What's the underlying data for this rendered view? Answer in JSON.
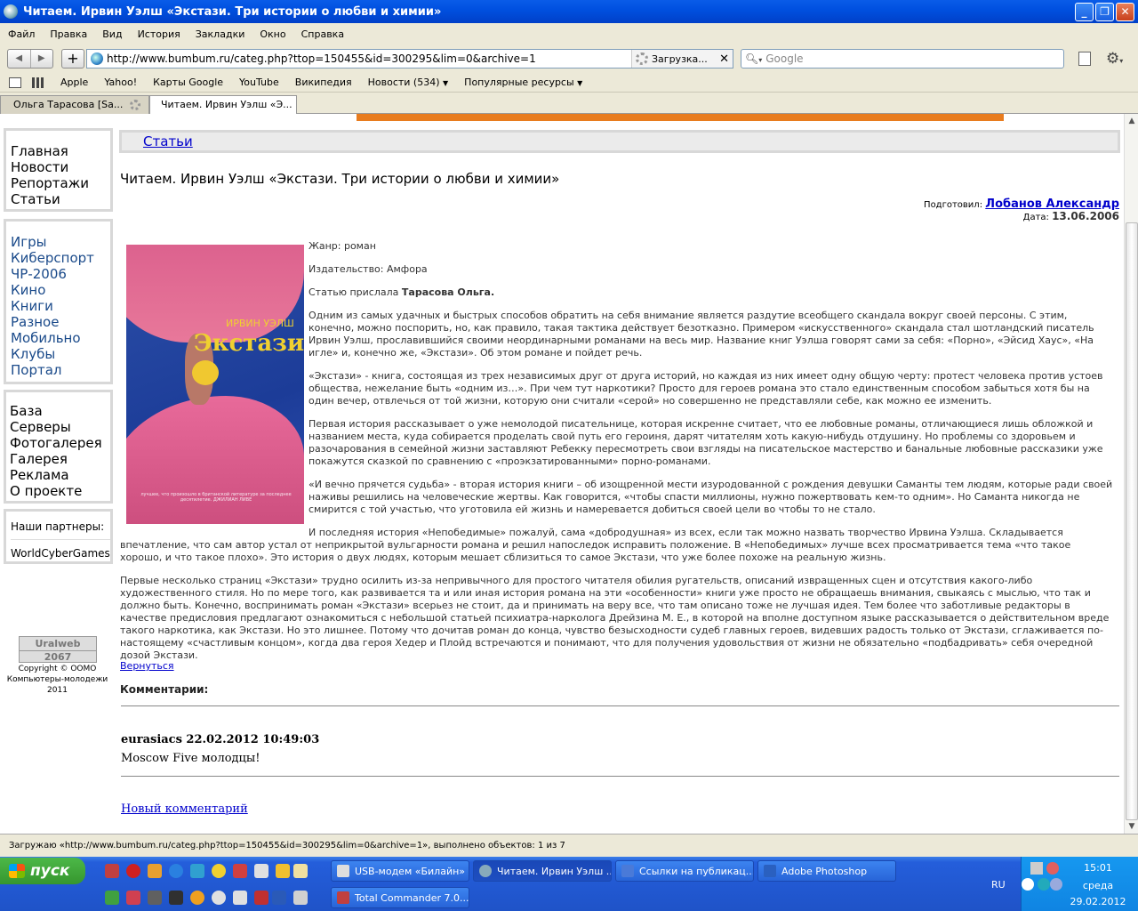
{
  "window": {
    "title": "Читаем. Ирвин Уэлш «Экстази. Три истории о любви и химии»"
  },
  "menu": [
    "Файл",
    "Правка",
    "Вид",
    "История",
    "Закладки",
    "Окно",
    "Справка"
  ],
  "nav": {
    "url": "http://www.bumbum.ru/categ.php?ttop=150455&id=300295&lim=0&archive=1",
    "loading_label": "Загрузка...",
    "search_placeholder": "Google"
  },
  "bookmarks": [
    "Apple",
    "Yahoo!",
    "Карты Google",
    "YouTube",
    "Википедия",
    "Новости (534)",
    "Популярные ресурсы"
  ],
  "tabs": [
    "Ольга Тарасова [Sa...",
    "Читаем. Ирвин Уэлш «Э..."
  ],
  "sidebar": {
    "main_links": [
      "Главная",
      "Новости",
      "Репортажи",
      "Статьи"
    ],
    "category_links": [
      "Игры",
      "Киберспорт",
      "ЧР-2006",
      "Кино",
      "Книги",
      "Разное",
      "Мобильно",
      "Клубы",
      "Портал"
    ],
    "other_links": [
      "База",
      "Серверы",
      "Фотогалерея",
      "Галерея",
      "Реклама",
      "О проекте"
    ],
    "partners_title": "Наши партнеры:",
    "partners": [
      "WorldCyberGames"
    ],
    "counter": {
      "name": "Uralweb",
      "value": "2067"
    },
    "copyright": "Copyright © ООМО Компьютеры-молодежи 2011"
  },
  "article": {
    "section": "Статьи",
    "title": "Читаем. Ирвин Уэлш «Экстази. Три истории о любви и химии»",
    "prepared_label": "Подготовил:",
    "author": "Лобанов Александр",
    "date_label": "Дата:",
    "date": "13.06.2006",
    "cover": {
      "author": "ИРВИН УЭЛШ",
      "title": "Экстази",
      "blurb": "лучшее, что произошло в британской литературе за последнее десятилетие. ДЖИЛИАН ЛИВЕ"
    },
    "genre": "Жанр: роман",
    "publisher": "Издательство: Амфора",
    "sent_by_label": "Статью прислала",
    "sent_by": "Тарасова Ольга.",
    "paragraphs": [
      "Одним из самых удачных и быстрых способов обратить на себя внимание является раздутие всеобщего скандала вокруг своей персоны. С этим, конечно, можно поспорить, но, как правило, такая тактика действует безотказно. Примером «искусственного» скандала стал шотландский писатель Ирвин Уэлш, прославившийся своими неординарными романами на весь мир. Название книг Уэлша говорят сами за себя: «Порно», «Эйсид Хаус», «На игле» и, конечно же, «Экстази». Об этом романе и пойдет речь.",
      "«Экстази» - книга, состоящая из трех независимых друг от друга историй, но каждая из них имеет одну общую черту: протест человека против устоев общества, нежелание быть «одним из…». При чем тут наркотики? Просто для героев романа это стало единственным способом забыться хотя бы на один вечер, отвлечься от той жизни, которую они считали «серой» но совершенно не представляли себе, как можно ее изменить.",
      "Первая история рассказывает о уже немолодой писательнице, которая искренне считает, что ее любовные романы, отличающиеся лишь обложкой и названием места, куда собирается проделать свой путь его героиня, дарят читателям хоть какую-нибудь отдушину. Но проблемы со здоровьем и разочарования в семейной жизни заставляют Ребекку пересмотреть свои взгляды на писательское мастерство и банальные любовные рассказики уже покажутся сказкой по сравнению с «проэкзатированными» порно-романами.",
      "«И вечно прячется судьба» - вторая история книги – об изощренной мести изуродованной с рождения девушки Саманты тем людям, которые ради своей наживы решились на человеческие жертвы. Как говорится, «чтобы спасти миллионы, нужно пожертвовать кем-то одним». Но Саманта никогда не смирится с той участью, что уготовила ей жизнь и намеревается добиться своей цели во чтобы то не стало.",
      "И последняя история «Непобедимые» пожалуй, сама «добродушная» из всех, если так можно назвать творчество Ирвина Уэлша. Складывается впечатление, что сам автор устал от неприкрытой вульгарности романа и решил напоследок исправить положение. В «Непобедимых» лучше всех просматривается тема «что такое хорошо, и что такое плохо». Это история о двух людях, которым мешает сблизиться то самое Экстази, что уже более похоже на реальную жизнь.",
      "Первые несколько страниц «Экстази» трудно осилить из-за непривычного для простого читателя обилия ругательств, описаний извращенных сцен и отсутствия какого-либо художественного стиля. Но по мере того, как развивается та и или иная история романа на эти «особенности» книги уже просто не обращаешь внимания, свыкаясь с мыслью, что так и должно быть. Конечно, воспринимать роман «Экстази» всерьез не стоит, да и принимать на веру все, что там описано тоже не лучшая идея. Тем более что заботливые редакторы в качестве предисловия предлагают ознакомиться с небольшой статьей психиатра-нарколога Дрейзина М. Е., в которой на вполне доступном языке рассказывается о действительном вреде такого наркотика, как Экстази. Но это лишнее. Потому что дочитав роман до конца, чувство безысходности судеб главных героев, видевших радость только от Экстази, сглаживается по-настоящему «счастливым концом», когда два героя Хедер и Плойд встречаются и понимают, что для получения удовольствия от жизни не обязательно «подбадривать» себя очередной дозой Экстази."
    ],
    "back_link": "Вернуться",
    "comments_label": "Комментарии:",
    "comments": [
      {
        "header": "eurasiacs 22.02.2012 10:49:03",
        "text": "Moscow Five молодцы!"
      }
    ],
    "new_comment": "Новый комментарий"
  },
  "statusbar": "Загружаю «http://www.bumbum.ru/categ.php?ttop=150455&id=300295&lim=0&archive=1», выполнено объектов: 1 из 7",
  "taskbar": {
    "start": "пуск",
    "tasks": [
      "USB-модем «Билайн»",
      "Читаем. Ирвин Уэлш ...",
      "Ссылки на публикац...",
      "Adobe Photoshop",
      "Total Commander 7.0..."
    ],
    "lang": "RU",
    "time": "15:01",
    "day": "среда",
    "date": "29.02.2012"
  }
}
